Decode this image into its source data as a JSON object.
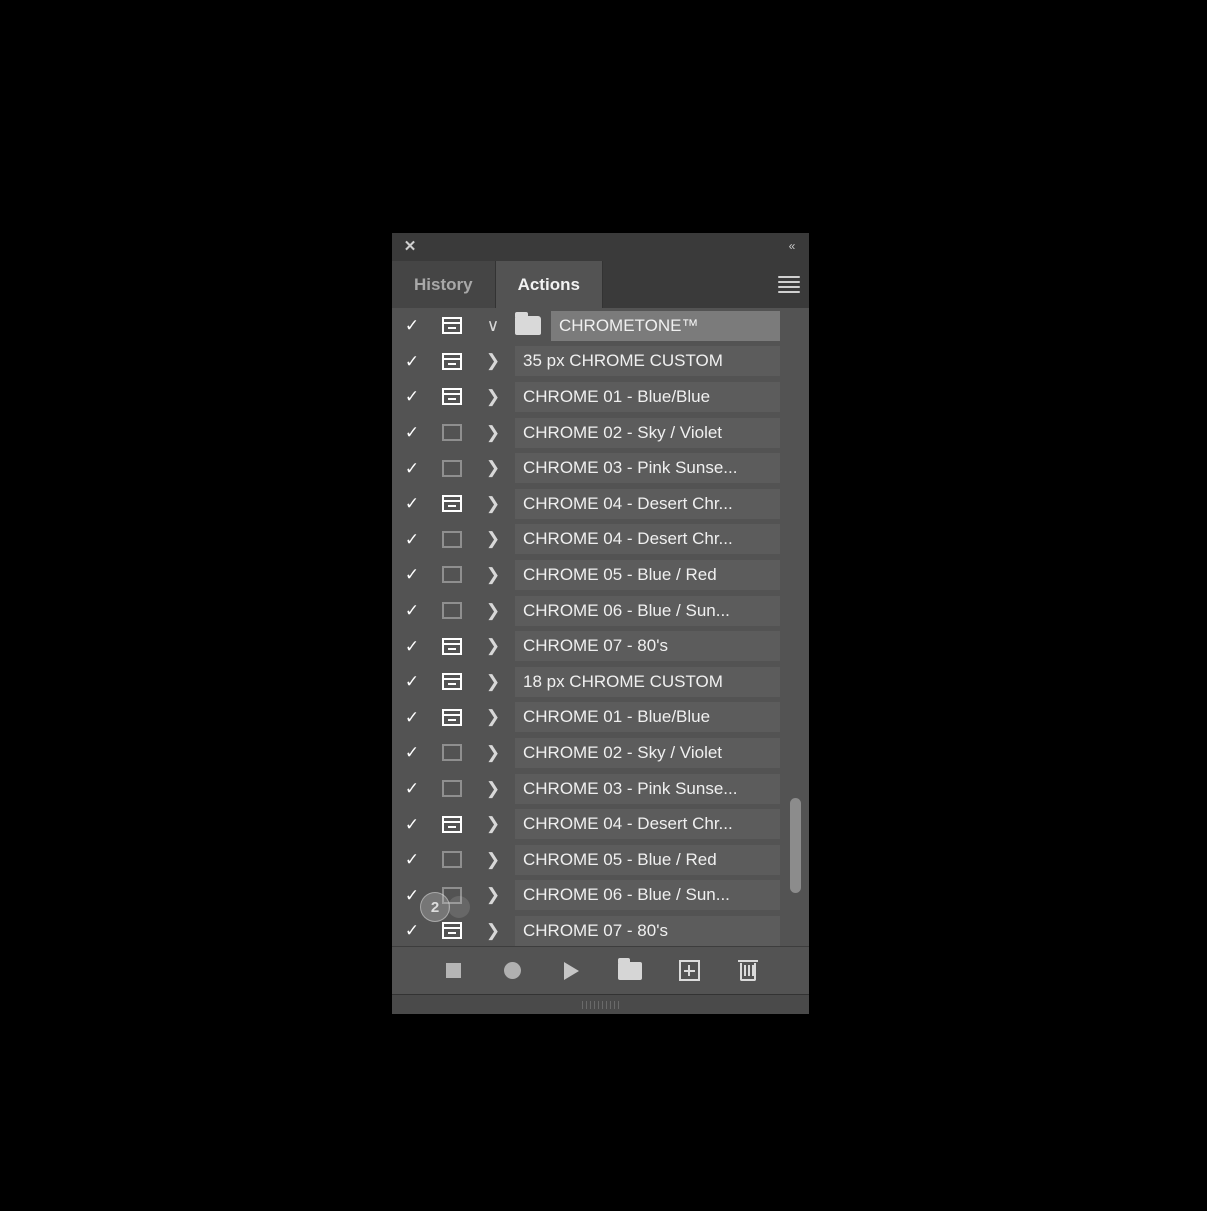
{
  "titlebar": {
    "close_label": "✕",
    "collapse_label": "«"
  },
  "tabs": [
    {
      "label": "History",
      "active": false
    },
    {
      "label": "Actions",
      "active": true
    }
  ],
  "panel_menu": {
    "icon": "hamburger-menu-icon"
  },
  "list": {
    "check_glyph": "✓",
    "chevron_right": "❯",
    "chevron_down": "∨",
    "rows": [
      {
        "label": "CHROMETONE™",
        "checked": true,
        "dialog": "on",
        "type": "set",
        "expanded": true,
        "selected": true
      },
      {
        "label": "35 px CHROME CUSTOM",
        "checked": true,
        "dialog": "on",
        "type": "action",
        "expanded": false,
        "selected": false
      },
      {
        "label": "CHROME 01 - Blue/Blue",
        "checked": true,
        "dialog": "on",
        "type": "action",
        "expanded": false,
        "selected": false
      },
      {
        "label": "CHROME 02 - Sky / Violet",
        "checked": true,
        "dialog": "off",
        "type": "action",
        "expanded": false,
        "selected": false
      },
      {
        "label": "CHROME 03 - Pink Sunse...",
        "checked": true,
        "dialog": "off",
        "type": "action",
        "expanded": false,
        "selected": false
      },
      {
        "label": "CHROME 04 - Desert Chr...",
        "checked": true,
        "dialog": "on",
        "type": "action",
        "expanded": false,
        "selected": false
      },
      {
        "label": "CHROME 04 - Desert Chr...",
        "checked": true,
        "dialog": "off",
        "type": "action",
        "expanded": false,
        "selected": false
      },
      {
        "label": "CHROME 05 - Blue / Red",
        "checked": true,
        "dialog": "off",
        "type": "action",
        "expanded": false,
        "selected": false
      },
      {
        "label": "CHROME 06 - Blue / Sun...",
        "checked": true,
        "dialog": "off",
        "type": "action",
        "expanded": false,
        "selected": false
      },
      {
        "label": "CHROME 07 - 80's",
        "checked": true,
        "dialog": "on",
        "type": "action",
        "expanded": false,
        "selected": false
      },
      {
        "label": "18 px CHROME CUSTOM",
        "checked": true,
        "dialog": "on",
        "type": "action",
        "expanded": false,
        "selected": false
      },
      {
        "label": "CHROME 01 - Blue/Blue",
        "checked": true,
        "dialog": "on",
        "type": "action",
        "expanded": false,
        "selected": false
      },
      {
        "label": "CHROME 02 - Sky / Violet",
        "checked": true,
        "dialog": "off",
        "type": "action",
        "expanded": false,
        "selected": false
      },
      {
        "label": "CHROME 03 - Pink Sunse...",
        "checked": true,
        "dialog": "off",
        "type": "action",
        "expanded": false,
        "selected": false
      },
      {
        "label": "CHROME 04 - Desert Chr...",
        "checked": true,
        "dialog": "on",
        "type": "action",
        "expanded": false,
        "selected": false
      },
      {
        "label": "CHROME 05 - Blue / Red",
        "checked": true,
        "dialog": "off",
        "type": "action",
        "expanded": false,
        "selected": false
      },
      {
        "label": "CHROME 06 - Blue / Sun...",
        "checked": true,
        "dialog": "off",
        "type": "action",
        "expanded": false,
        "selected": false
      },
      {
        "label": "CHROME 07 - 80's",
        "checked": true,
        "dialog": "on",
        "type": "action",
        "expanded": false,
        "selected": false
      }
    ]
  },
  "cursor": {
    "badge_label": "2"
  },
  "toolbar": {
    "buttons": [
      {
        "name": "stop-button",
        "icon": "stop-icon"
      },
      {
        "name": "record-button",
        "icon": "record-icon"
      },
      {
        "name": "play-button",
        "icon": "play-icon"
      },
      {
        "name": "new-set-button",
        "icon": "folder-icon"
      },
      {
        "name": "new-action-button",
        "icon": "plus-box-icon"
      },
      {
        "name": "delete-button",
        "icon": "trash-icon"
      }
    ]
  },
  "colors": {
    "panel_bg": "#535353",
    "header_bg": "#3a3a3a",
    "row_label_bg": "#5c5c5c",
    "selected_row_bg": "#7b7b7b",
    "text": "#f0f0f0",
    "inactive_tab_text": "#a8a8a8"
  }
}
